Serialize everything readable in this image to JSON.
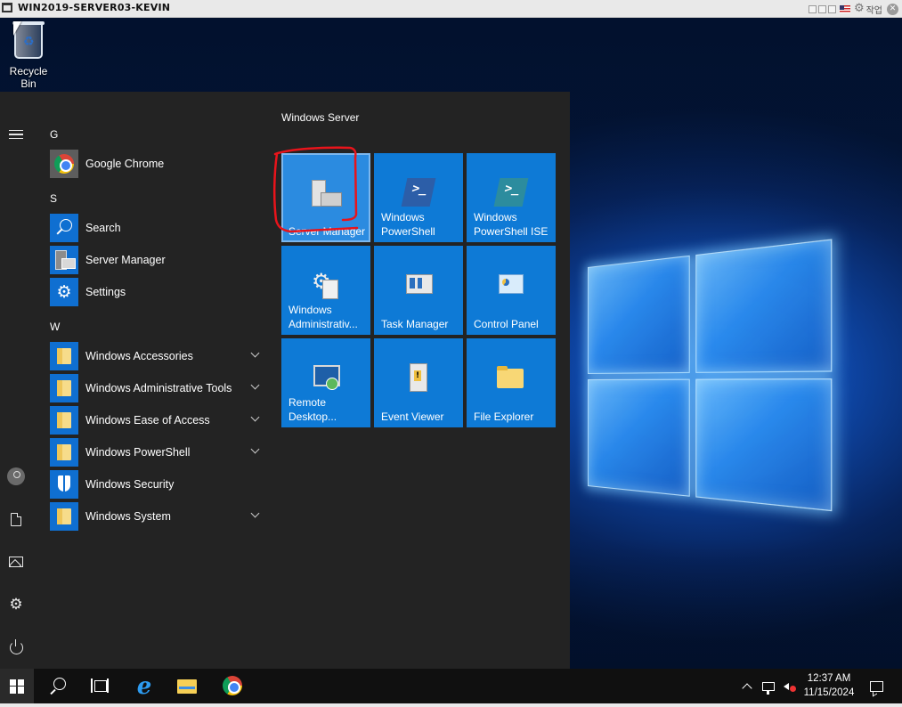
{
  "vm_window": {
    "title": "WIN2019-SERVER03-KEVIN",
    "action_label": "작업",
    "controls": [
      "restore-icon",
      "minimize-icon",
      "fullscreen-icon",
      "flag-icon",
      "gear-icon",
      "close-icon"
    ]
  },
  "desktop": {
    "icons": [
      {
        "label": "Recycle Bin",
        "icon": "recycle-bin-icon"
      }
    ]
  },
  "start_menu": {
    "rail": [
      "hamburger-icon",
      "user-avatar-icon",
      "documents-icon",
      "pictures-icon",
      "settings-gear-icon",
      "power-icon"
    ],
    "letters": [
      "G",
      "S",
      "W"
    ],
    "apps": [
      {
        "label": "Google Chrome",
        "icon": "chrome-icon",
        "expandable": false
      },
      {
        "label": "Search",
        "icon": "search-icon",
        "expandable": false
      },
      {
        "label": "Server Manager",
        "icon": "server-manager-icon",
        "expandable": false
      },
      {
        "label": "Settings",
        "icon": "settings-icon",
        "expandable": false
      },
      {
        "label": "Windows Accessories",
        "icon": "folder-icon",
        "expandable": true
      },
      {
        "label": "Windows Administrative Tools",
        "icon": "folder-icon",
        "expandable": true
      },
      {
        "label": "Windows Ease of Access",
        "icon": "folder-icon",
        "expandable": true
      },
      {
        "label": "Windows PowerShell",
        "icon": "folder-icon",
        "expandable": true
      },
      {
        "label": "Windows Security",
        "icon": "shield-icon",
        "expandable": false
      },
      {
        "label": "Windows System",
        "icon": "folder-icon",
        "expandable": true
      }
    ],
    "tile_group": {
      "label": "Windows Server",
      "tiles": [
        {
          "label": "Server Manager",
          "icon": "server-manager-icon",
          "selected": true
        },
        {
          "label": "Windows\nPowerShell",
          "icon": "powershell-icon"
        },
        {
          "label": "Windows\nPowerShell ISE",
          "icon": "powershell-ise-icon"
        },
        {
          "label": "Windows\nAdministrativ...",
          "icon": "admin-tools-icon"
        },
        {
          "label": "Task Manager",
          "icon": "task-manager-icon"
        },
        {
          "label": "Control Panel",
          "icon": "control-panel-icon"
        },
        {
          "label": "Remote\nDesktop...",
          "icon": "remote-desktop-icon"
        },
        {
          "label": "Event Viewer",
          "icon": "event-viewer-icon"
        },
        {
          "label": "File Explorer",
          "icon": "file-explorer-icon"
        }
      ]
    }
  },
  "taskbar": {
    "items": [
      "start-icon",
      "search-icon",
      "task-view-icon",
      "internet-explorer-icon",
      "file-explorer-icon",
      "chrome-icon"
    ],
    "tray": [
      "chevron-up-icon",
      "network-icon",
      "volume-muted-icon"
    ],
    "time": "12:37 AM",
    "date": "11/15/2024"
  },
  "annotation": {
    "color": "#e8141b",
    "shape": "hand-drawn-box"
  },
  "colors": {
    "tile": "#0e7ad6",
    "start_bg": "#232323",
    "taskbar_bg": "#101010"
  }
}
